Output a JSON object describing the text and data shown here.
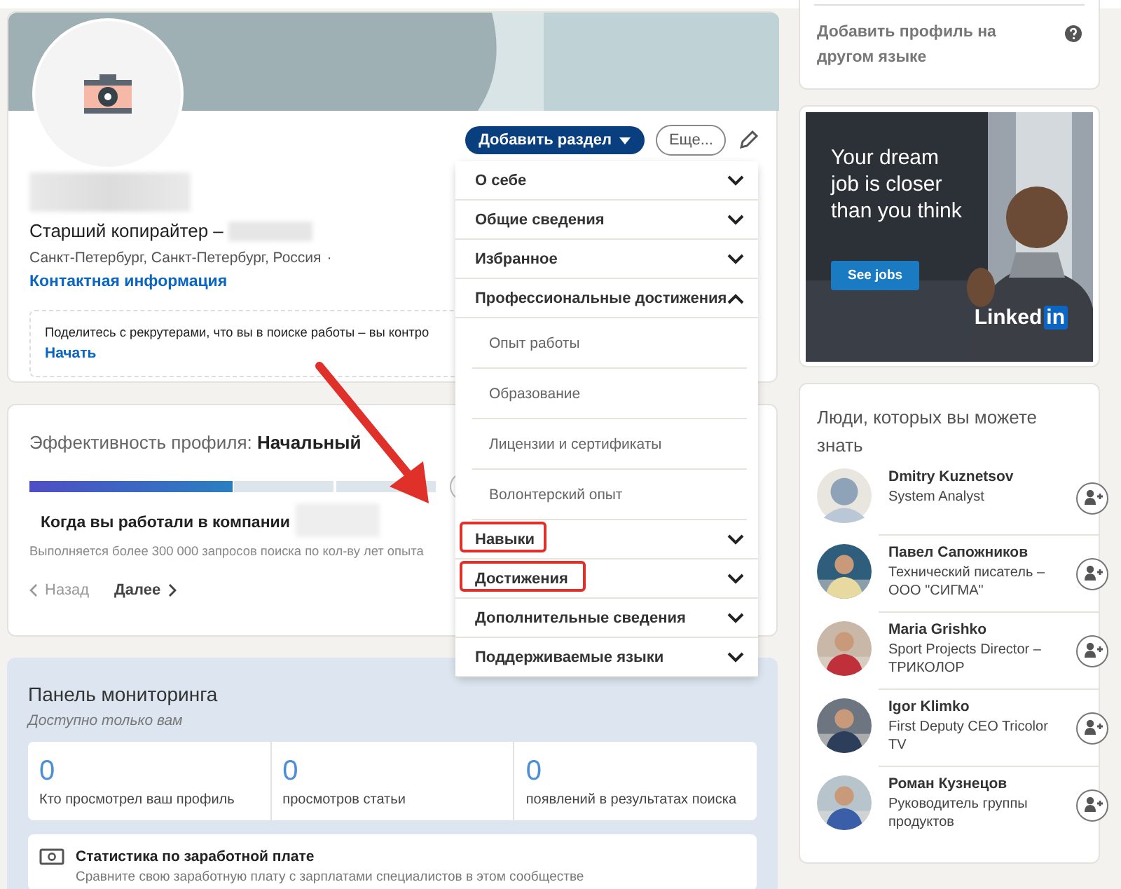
{
  "profile": {
    "headline": "Старший копирайтер –",
    "location": "Санкт-Петербург, Санкт-Петербург, Россия",
    "location_sep": "·",
    "contact_link": "Контактная информация",
    "add_section_button": "Добавить раздел",
    "more_button": "Еще...",
    "recruiter_notice": "Поделитесь с рекрутерами, что вы в поиске работы – вы контро",
    "recruiter_link": "Начать"
  },
  "add_section_menu": [
    {
      "label": "О себе",
      "expanded": false,
      "highlighted": false
    },
    {
      "label": "Общие сведения",
      "expanded": false,
      "highlighted": false
    },
    {
      "label": "Избранное",
      "expanded": false,
      "highlighted": false
    },
    {
      "label": "Профессиональные достижения",
      "expanded": true,
      "highlighted": false,
      "children": [
        {
          "label": "Опыт работы"
        },
        {
          "label": "Образование"
        },
        {
          "label": "Лицензии и сертификаты"
        },
        {
          "label": "Волонтерский опыт"
        }
      ]
    },
    {
      "label": "Навыки",
      "expanded": false,
      "highlighted": true
    },
    {
      "label": "Достижения",
      "expanded": false,
      "highlighted": true
    },
    {
      "label": "Дополнительные сведения",
      "expanded": false,
      "highlighted": false
    },
    {
      "label": "Поддерживаемые языки",
      "expanded": false,
      "highlighted": false
    }
  ],
  "profile_strength": {
    "title": "Эффективность профиля: **Начальный**",
    "level": 0.5,
    "prompt_title": "Когда вы работали в компании",
    "prompt_text": "Выполняется более 300 000 запросов поиска по кол-ву лет опыта",
    "back_button": "Назад",
    "next_button": "Далее"
  },
  "dashboard": {
    "title": "Панель мониторинга",
    "subtitle": "Доступно только вам",
    "stats": [
      {
        "value": "0",
        "label": "Кто просмотрел ваш профиль"
      },
      {
        "value": "0",
        "label": "просмотров статьи"
      },
      {
        "value": "0",
        "label": "появлений в результатах поиска"
      }
    ],
    "salary_title": "Статистика по заработной плате",
    "salary_text": "Сравните свою заработную плату с зарплатами специалистов в этом сообществе"
  },
  "language_card": {
    "link": "Добавить профиль на другом языке"
  },
  "ad": {
    "kind": "picture",
    "headline": "Your dream job is closer than you think",
    "button": "See jobs",
    "logo_word": "Linked",
    "logo_box": "in"
  },
  "people": {
    "title": "Люди, которых вы можете знать",
    "items": [
      {
        "name": "Dmitry Kuznetsov",
        "title": "System Analyst",
        "photo": false
      },
      {
        "name": "Павел Сапожников",
        "title": "Технический писатель – ООО \"СИГМА\"",
        "photo": true
      },
      {
        "name": "Maria Grishko",
        "title": "Sport Projects Director – ТРИКОЛОР",
        "photo": true
      },
      {
        "name": "Igor Klimko",
        "title": "First Deputy CEO Tricolor TV",
        "photo": true
      },
      {
        "name": "Роман Кузнецов",
        "title": "Руководитель группы продуктов",
        "photo": true
      }
    ]
  }
}
